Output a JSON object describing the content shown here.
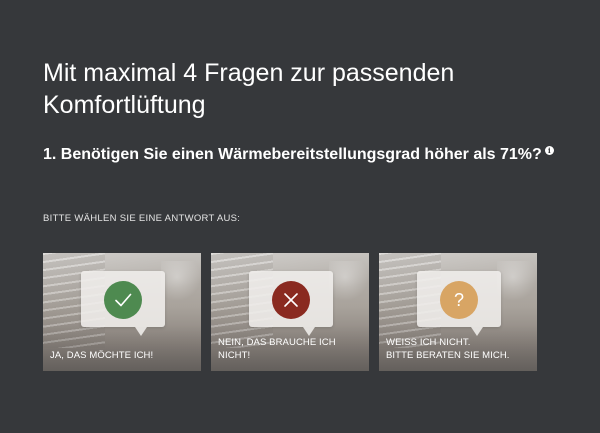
{
  "headline": "Mit maximal 4 Fragen zur passenden Komfortlüftung",
  "question": {
    "text": "1. Benötigen Sie einen Wärmebereitstellungsgrad höher als 71%?",
    "info_icon": "info-icon"
  },
  "instruction": "BITTE WÄHLEN SIE EINE ANTWORT AUS:",
  "answers": [
    {
      "label": "JA, DAS MÖCHTE  ICH!",
      "icon": "check-icon",
      "color": "#4e8a50"
    },
    {
      "label": "NEIN, DAS BRAUCHE ICH NICHT!",
      "icon": "close-icon",
      "color": "#8a2a20"
    },
    {
      "label": "WEISS ICH NICHT.\nBITTE BERATEN SIE MICH.",
      "icon": "question-icon",
      "glyph": "?",
      "color": "#d8a564"
    }
  ],
  "colors": {
    "background": "#36383b",
    "text": "#ffffff"
  }
}
